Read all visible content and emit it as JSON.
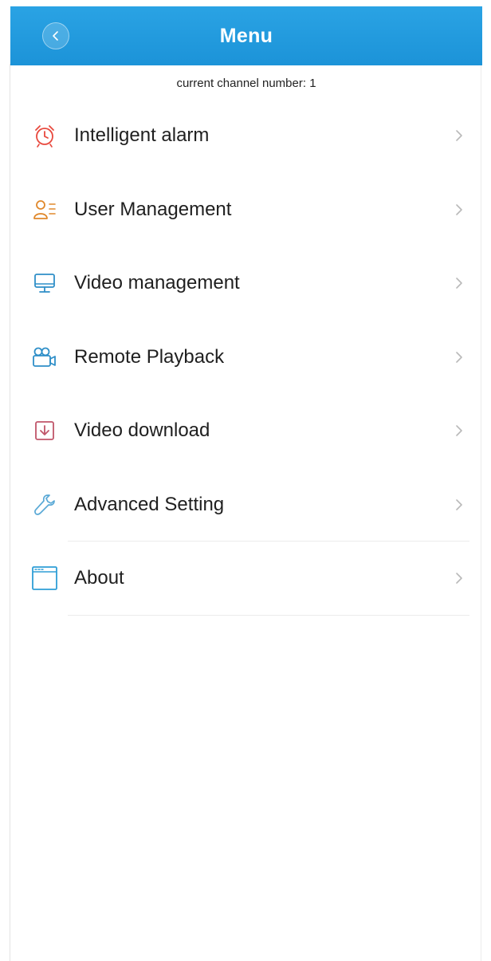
{
  "header": {
    "title": "Menu",
    "back_icon": "chevron-left-icon",
    "bar_color": "#1f97dc"
  },
  "channel_text": "current channel number: 1",
  "menu": {
    "items": [
      {
        "label": "Intelligent alarm",
        "icon": "alarm-clock-icon",
        "color": "#e8493e"
      },
      {
        "label": "User Management",
        "icon": "user-list-icon",
        "color": "#e0882b"
      },
      {
        "label": "Video management",
        "icon": "monitor-icon",
        "color": "#2f8fc8"
      },
      {
        "label": "Remote Playback",
        "icon": "video-camera-icon",
        "color": "#2f8fc8"
      },
      {
        "label": "Video download",
        "icon": "download-box-icon",
        "color": "#c0566a"
      },
      {
        "label": "Advanced Setting",
        "icon": "wrench-icon",
        "color": "#5aa9d6"
      },
      {
        "label": "About",
        "icon": "browser-window-icon",
        "color": "#2f9ed6"
      }
    ]
  }
}
